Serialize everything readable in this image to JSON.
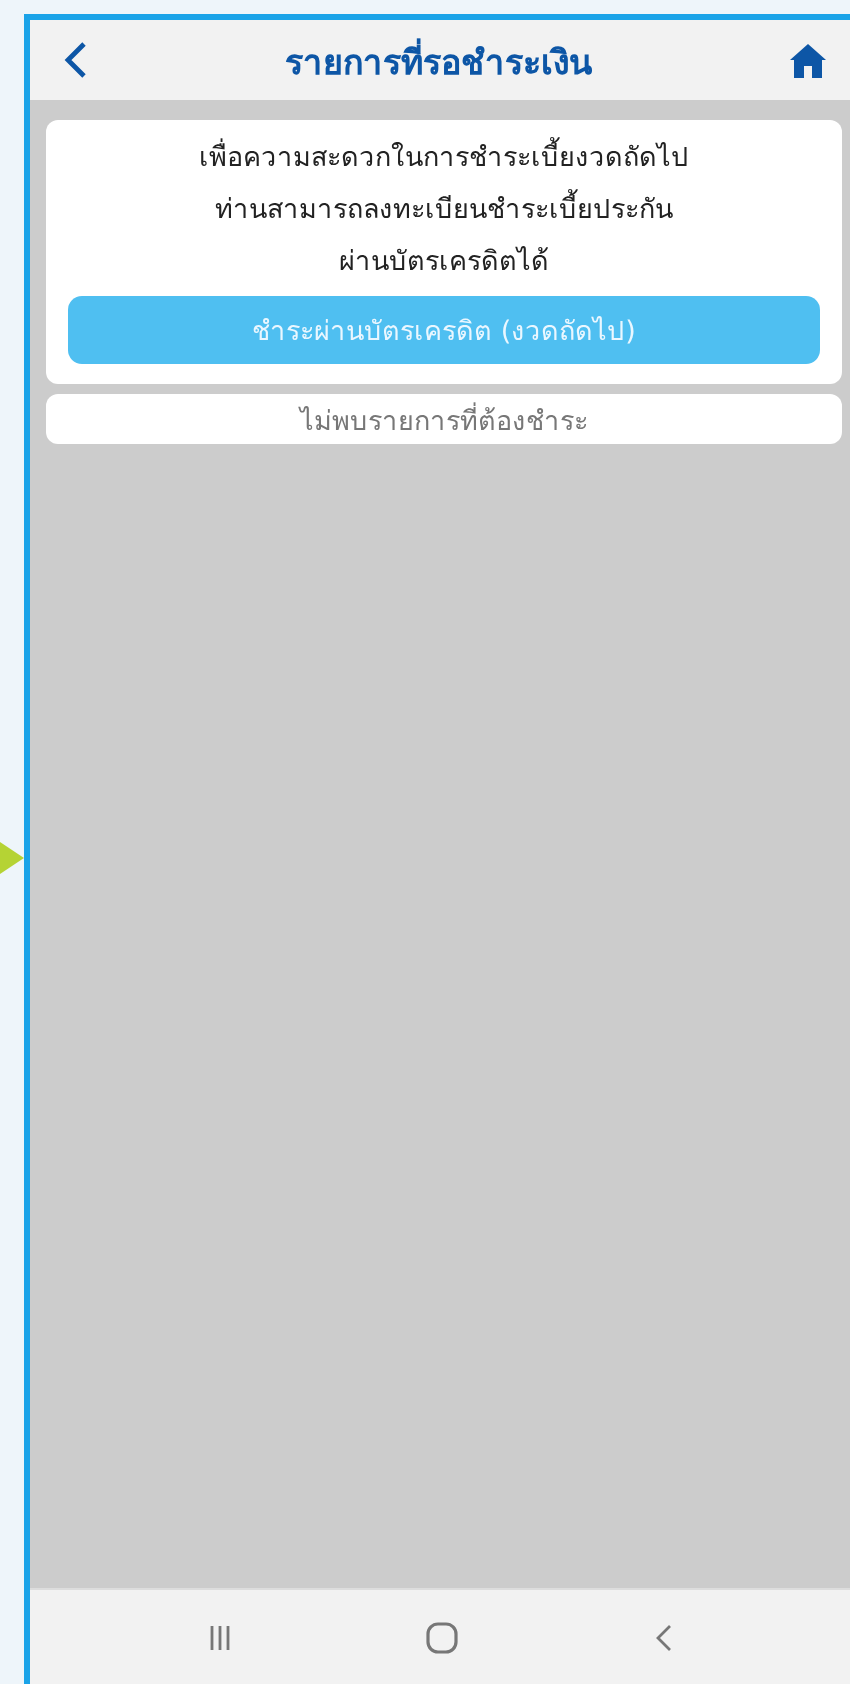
{
  "header": {
    "title": "รายการที่รอชำระเงิน"
  },
  "notice": {
    "lines": [
      "เพื่อความสะดวกในการชำระเบี้ยงวดถัดไป",
      "ท่านสามารถลงทะเบียนชำระเบี้ยประกัน",
      "ผ่านบัตรเครดิตได้"
    ],
    "button": "ชำระผ่านบัตรเครดิต (งวดถัดไป)"
  },
  "empty_message": "ไม่พบรายการที่ต้องชำระ"
}
